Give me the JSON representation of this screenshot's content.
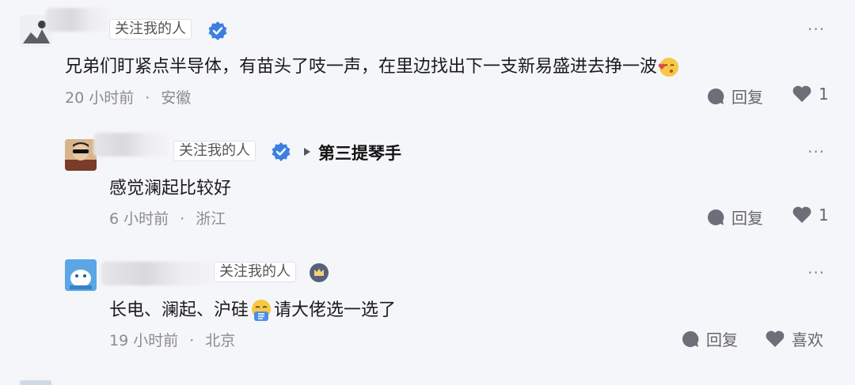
{
  "comments": [
    {
      "tag": "关注我的人",
      "text": "兄弟们盯紧点半导体，有苗头了吱一声，在里边找出下一支新易盛进去挣一波",
      "time": "20 小时前",
      "location": "安徽",
      "reply_label": "回复",
      "like_count": "1",
      "more": "···"
    },
    {
      "tag": "关注我的人",
      "reply_to": "第三提琴手",
      "text": "感觉澜起比较好",
      "time": "6 小时前",
      "location": "浙江",
      "reply_label": "回复",
      "like_count": "1",
      "more": "···"
    },
    {
      "tag": "关注我的人",
      "text_before": "长电、澜起、沪硅",
      "text_after": "请大佬选一选了",
      "time": "19 小时前",
      "location": "北京",
      "reply_label": "回复",
      "like_label": "喜欢",
      "more": "···"
    }
  ],
  "meta_separator": "·",
  "colors": {
    "verify_blue": "#3d7fe0",
    "icon_gray": "#6b6f78",
    "background": "#f5f6fa"
  },
  "icons": [
    "verified-badge-icon",
    "reply-bubble-icon",
    "heart-icon",
    "crown-badge-icon",
    "more-icon",
    "arrow-right-icon",
    "smile-kiss-emoji",
    "sweat-emoji"
  ]
}
